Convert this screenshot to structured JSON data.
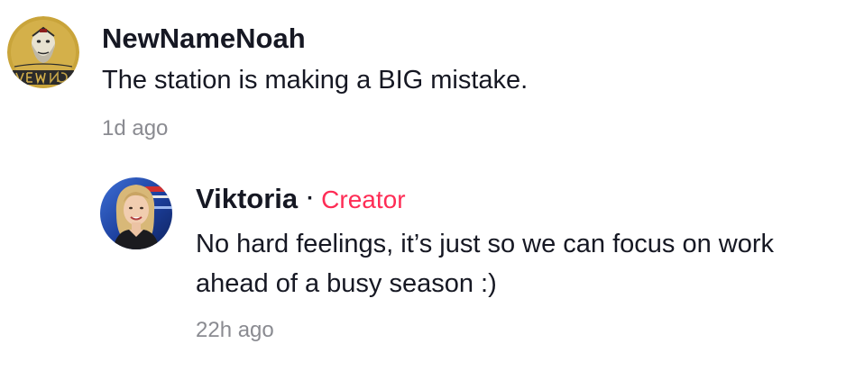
{
  "comments": [
    {
      "username": "NewNameNoah",
      "text": "The station is making a BIG mistake.",
      "timestamp": "1d ago",
      "avatar_icon": "gold-logo-avatar",
      "avatar_lettering": "NEWNAMENOAH",
      "avatar_colors": {
        "background": "#c9a43a",
        "ink": "#2b2b2b"
      }
    },
    {
      "username": "Viktoria",
      "separator": "·",
      "badge": "Creator",
      "text": "No hard feelings, it’s just so we can focus on work ahead of a busy season :)",
      "timestamp": "22h ago",
      "avatar_icon": "user-photo-avatar"
    }
  ],
  "colors": {
    "text": "#161823",
    "timestamp": "#8a8b91",
    "creator_badge": "#fe2c55",
    "background": "#ffffff"
  }
}
